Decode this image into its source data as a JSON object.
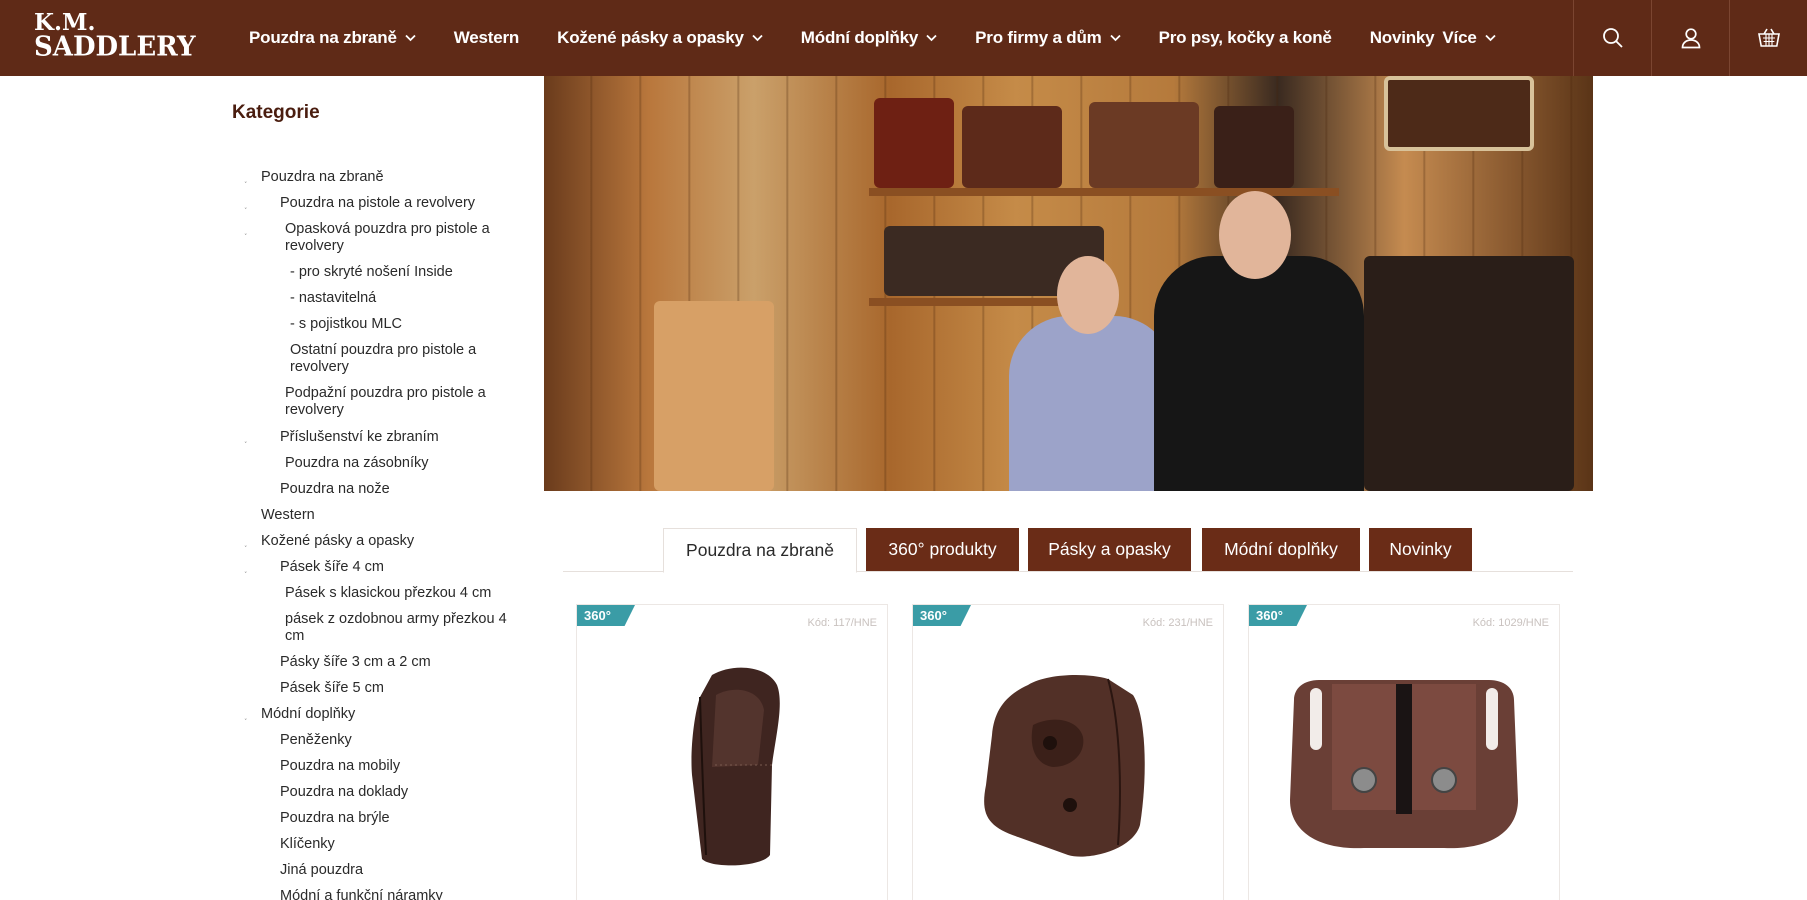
{
  "logo": {
    "line1": "K.M.",
    "line2": "SADDLERY"
  },
  "nav": [
    {
      "label": "Pouzdra na zbraně",
      "has_dropdown": true
    },
    {
      "label": "Western",
      "has_dropdown": false
    },
    {
      "label": "Kožené pásky a opasky",
      "has_dropdown": true
    },
    {
      "label": "Módní doplňky",
      "has_dropdown": true
    },
    {
      "label": "Pro firmy a dům",
      "has_dropdown": true
    },
    {
      "label": "Pro psy, kočky a koně",
      "has_dropdown": false
    },
    {
      "label": "Novinky",
      "has_dropdown": false
    },
    {
      "label": "Více",
      "has_dropdown": true
    }
  ],
  "header_icons": [
    "search-icon",
    "user-icon",
    "basket-icon"
  ],
  "sidebar": {
    "title": "Kategorie",
    "items": [
      {
        "label": "Pouzdra na zbraně",
        "level": 0,
        "bullet": true
      },
      {
        "label": "Pouzdra na pistole a revolvery",
        "level": 1,
        "bullet": true
      },
      {
        "label": "Opasková pouzdra pro pistole a revolvery",
        "level": 2,
        "bullet": true
      },
      {
        "label": "- pro skryté nošení Inside",
        "level": 3,
        "bullet": false
      },
      {
        "label": "- nastavitelná",
        "level": 3,
        "bullet": false
      },
      {
        "label": "- s pojistkou MLC",
        "level": 3,
        "bullet": false
      },
      {
        "label": "Ostatní pouzdra pro pistole a revolvery",
        "level": 3,
        "bullet": false
      },
      {
        "label": "Podpažní pouzdra pro pistole a revolvery",
        "level": 2,
        "bullet": false
      },
      {
        "label": "Příslušenství ke zbraním",
        "level": 1,
        "bullet": true
      },
      {
        "label": "Pouzdra na zásobníky",
        "level": 2,
        "bullet": false
      },
      {
        "label": "Pouzdra na nože",
        "level": 1,
        "bullet": false
      },
      {
        "label": "Western",
        "level": 0,
        "bullet": false
      },
      {
        "label": "Kožené pásky a opasky",
        "level": 0,
        "bullet": true
      },
      {
        "label": "Pásek šíře 4 cm",
        "level": 1,
        "bullet": true
      },
      {
        "label": "Pásek s klasickou přezkou 4 cm",
        "level": 2,
        "bullet": false
      },
      {
        "label": "pásek z ozdobnou army přezkou 4 cm",
        "level": 2,
        "bullet": false
      },
      {
        "label": "Pásky šíře 3 cm a 2 cm",
        "level": 1,
        "bullet": false
      },
      {
        "label": "Pásek šíře 5 cm",
        "level": 1,
        "bullet": false
      },
      {
        "label": "Módní doplňky",
        "level": 0,
        "bullet": true
      },
      {
        "label": "Peněženky",
        "level": 1,
        "bullet": false
      },
      {
        "label": "Pouzdra na mobily",
        "level": 1,
        "bullet": false
      },
      {
        "label": "Pouzdra na doklady",
        "level": 1,
        "bullet": false
      },
      {
        "label": "Pouzdra na brýle",
        "level": 1,
        "bullet": false
      },
      {
        "label": "Klíčenky",
        "level": 1,
        "bullet": false
      },
      {
        "label": "Jiná pouzdra",
        "level": 1,
        "bullet": false
      },
      {
        "label": "Módní a funkční náramky hodinkové řemínky",
        "level": 1,
        "bullet": false
      }
    ]
  },
  "tabs": [
    {
      "label": "Pouzdra na zbraně",
      "active": true
    },
    {
      "label": "360° produkty",
      "active": false
    },
    {
      "label": "Pásky a opasky",
      "active": false
    },
    {
      "label": "Módní doplňky",
      "active": false
    },
    {
      "label": "Novinky",
      "active": false
    }
  ],
  "products": [
    {
      "badge": "360°",
      "code": "Kód: 117/HNE",
      "image": "revolver-holster"
    },
    {
      "badge": "360°",
      "code": "Kód: 231/HNE",
      "image": "pistol-holster"
    },
    {
      "badge": "360°",
      "code": "Kód: 1029/HNE",
      "image": "double-magazine-pouch"
    }
  ],
  "colors": {
    "brand": "#5f2a17",
    "tab_inactive": "#6a2c17",
    "badge": "#3a9ca6"
  }
}
